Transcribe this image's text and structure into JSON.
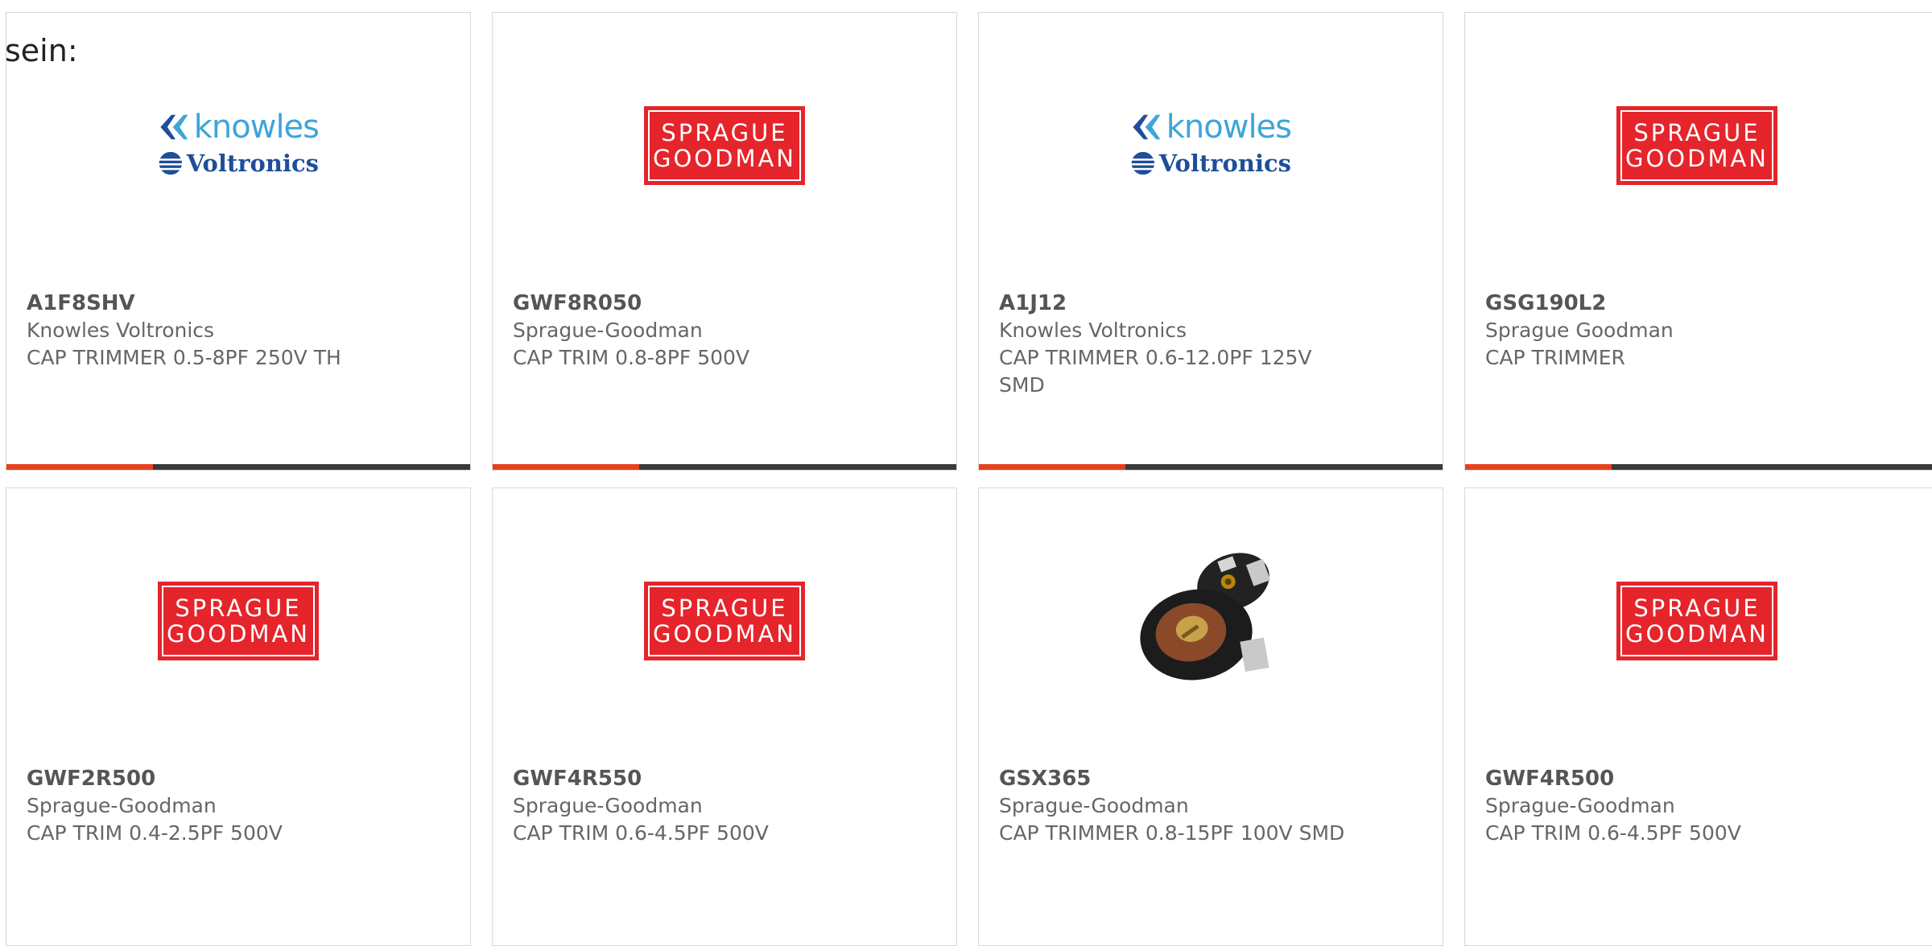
{
  "heading": "sein:",
  "products": [
    {
      "part": "A1F8SHV",
      "manufacturer": "Knowles Voltronics",
      "description": "CAP TRIMMER 0.5-8PF 250V TH",
      "logo": "knowles-voltronics-logo"
    },
    {
      "part": "GWF8R050",
      "manufacturer": "Sprague-Goodman",
      "description": "CAP TRIM 0.8-8PF 500V",
      "logo": "sprague-goodman-logo"
    },
    {
      "part": "A1J12",
      "manufacturer": "Knowles Voltronics",
      "description": "CAP TRIMMER 0.6-12.0PF 125V SMD",
      "logo": "knowles-voltronics-logo"
    },
    {
      "part": "GSG190L2",
      "manufacturer": "Sprague Goodman",
      "description": "CAP TRIMMER",
      "logo": "sprague-goodman-logo"
    },
    {
      "part": "GWF2R500",
      "manufacturer": "Sprague-Goodman",
      "description": "CAP TRIM 0.4-2.5PF 500V",
      "logo": "sprague-goodman-logo"
    },
    {
      "part": "GWF4R550",
      "manufacturer": "Sprague-Goodman",
      "description": "CAP TRIM 0.6-4.5PF 500V",
      "logo": "sprague-goodman-logo"
    },
    {
      "part": "GSX365",
      "manufacturer": "Sprague-Goodman",
      "description": "CAP TRIMMER 0.8-15PF 100V SMD",
      "logo": "trimmer-capacitor-photo"
    },
    {
      "part": "GWF4R500",
      "manufacturer": "Sprague-Goodman",
      "description": "CAP TRIM 0.6-4.5PF 500V",
      "logo": "sprague-goodman-logo"
    }
  ],
  "logos": {
    "sprague_line1": "SPRAGUE",
    "sprague_line2": "GOODMAN",
    "knowles_word": "knowles",
    "voltronics_word": "Voltronics"
  },
  "colors": {
    "accent": "#e8401b",
    "bar": "#3a3a3a",
    "sprague_red": "#e5242b",
    "knowles_blue": "#3ea5d8",
    "voltronics_navy": "#1f4e9a"
  }
}
